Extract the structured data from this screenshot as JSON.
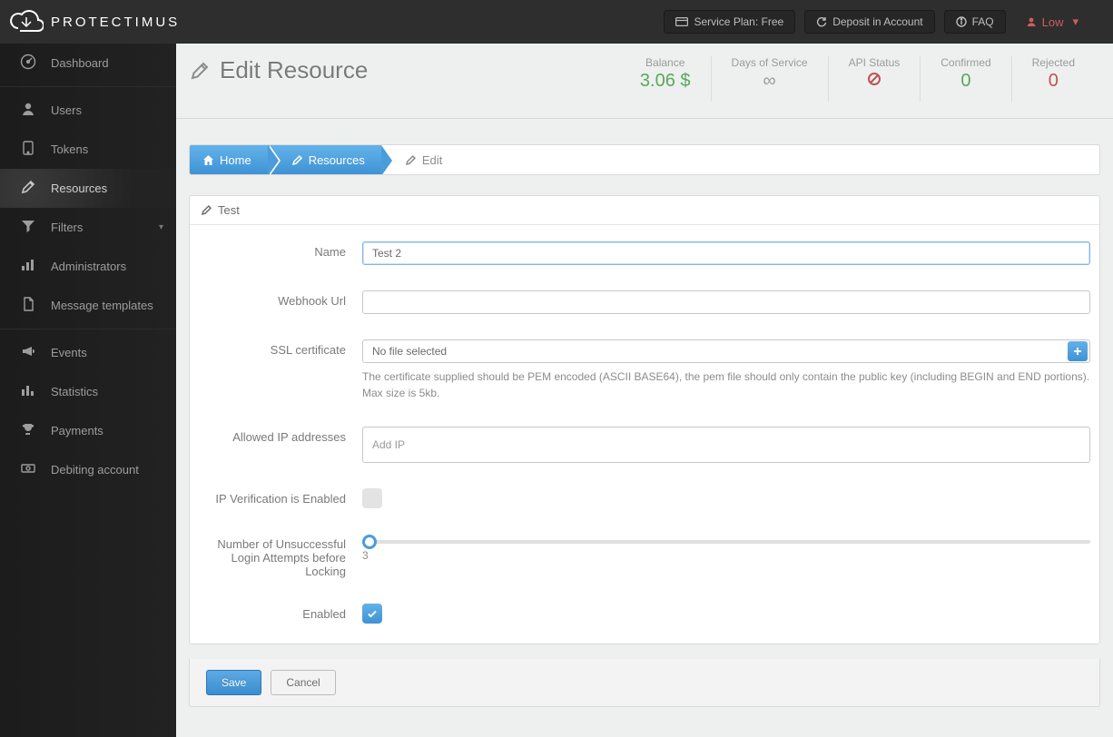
{
  "brand": "PROTECTIMUS",
  "topbar": {
    "service_plan": "Service Plan: Free",
    "deposit": "Deposit in Account",
    "faq": "FAQ",
    "user_level": "Low"
  },
  "sidebar": {
    "items": [
      {
        "label": "Dashboard"
      },
      {
        "label": "Users"
      },
      {
        "label": "Tokens"
      },
      {
        "label": "Resources"
      },
      {
        "label": "Filters"
      },
      {
        "label": "Administrators"
      },
      {
        "label": "Message templates"
      },
      {
        "label": "Events"
      },
      {
        "label": "Statistics"
      },
      {
        "label": "Payments"
      },
      {
        "label": "Debiting account"
      }
    ]
  },
  "page": {
    "title": "Edit Resource"
  },
  "stats": {
    "balance_label": "Balance",
    "balance_value": "3.06 $",
    "days_label": "Days of Service",
    "days_value": "∞",
    "api_label": "API Status",
    "confirmed_label": "Confirmed",
    "confirmed_value": "0",
    "rejected_label": "Rejected",
    "rejected_value": "0"
  },
  "breadcrumb": {
    "home": "Home",
    "resources": "Resources",
    "edit": "Edit"
  },
  "panel": {
    "header": "Test"
  },
  "form": {
    "name_label": "Name",
    "name_value": "Test 2",
    "webhook_label": "Webhook Url",
    "webhook_value": "",
    "ssl_label": "SSL certificate",
    "ssl_placeholder": "No file selected",
    "ssl_help": "The certificate supplied should be PEM encoded (ASCII BASE64), the pem file should only contain the public key (including BEGIN and END portions). Max size is 5kb.",
    "allowed_ip_label": "Allowed IP addresses",
    "allowed_ip_placeholder": "Add IP",
    "ip_verify_label": "IP Verification is Enabled",
    "attempts_label": "Number of Unsuccessful Login Attempts before Locking",
    "attempts_value": "3",
    "enabled_label": "Enabled"
  },
  "actions": {
    "save": "Save",
    "cancel": "Cancel"
  }
}
